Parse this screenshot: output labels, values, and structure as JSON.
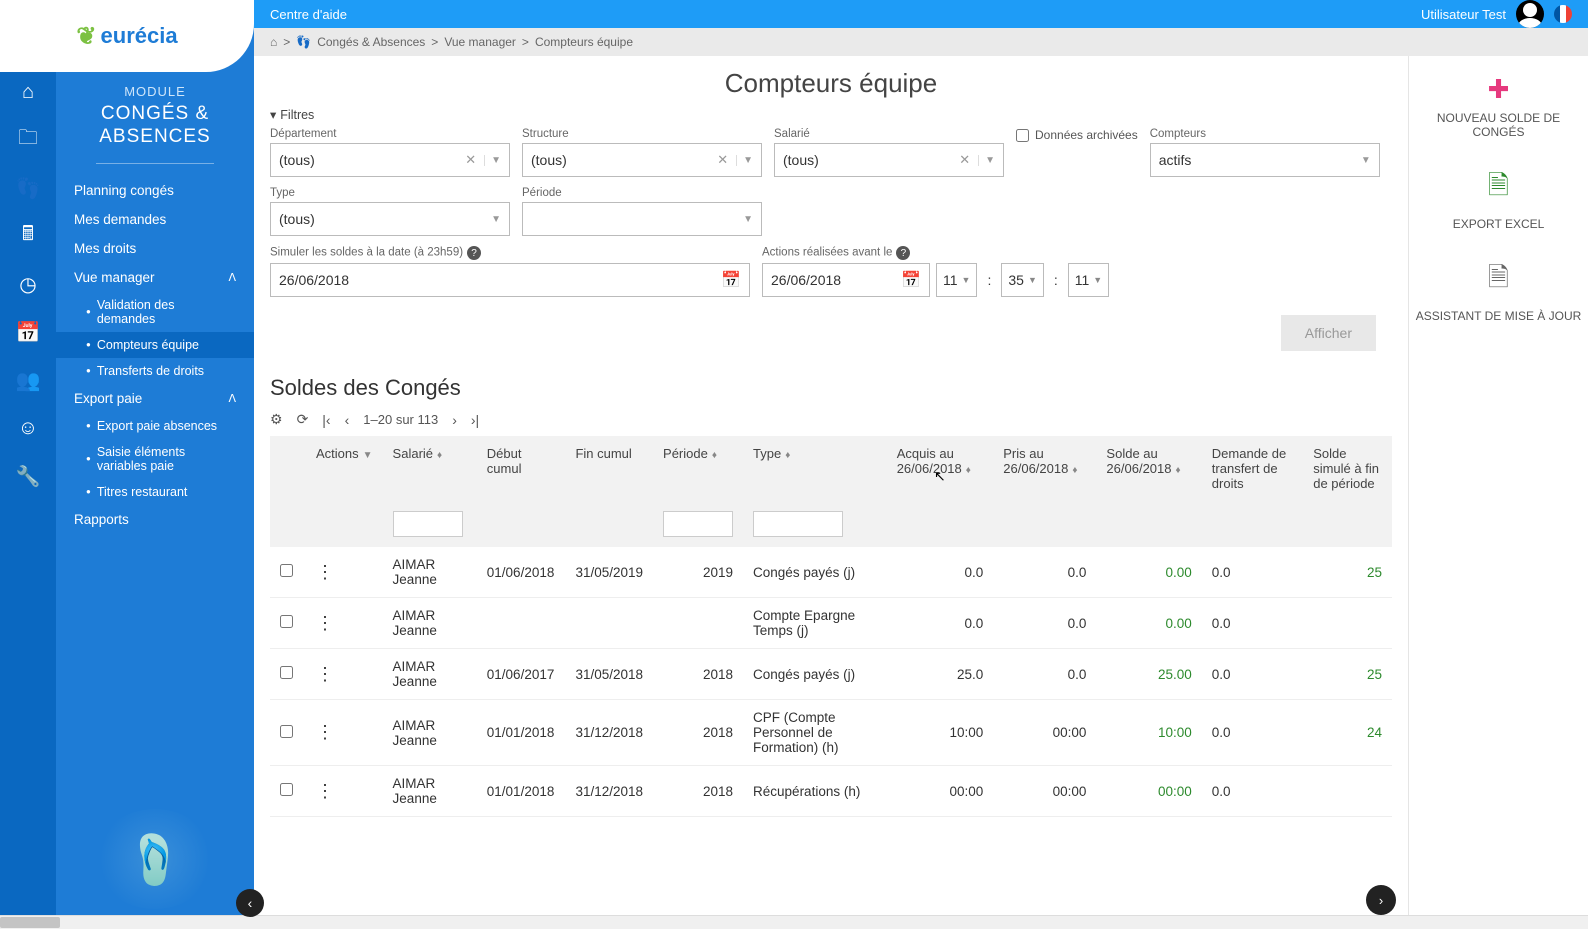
{
  "brand": {
    "name": "eurécia"
  },
  "topbar": {
    "help": "Centre d'aide",
    "user": "Utilisateur  Test"
  },
  "breadcrumb": {
    "sep": ">",
    "mod": "Congés & Absences",
    "view": "Vue manager",
    "page": "Compteurs équipe"
  },
  "sidebar": {
    "module_label": "MODULE",
    "module_name": "CONGÉS & ABSENCES",
    "items": {
      "planning": "Planning congés",
      "demandes": "Mes demandes",
      "droits": "Mes droits",
      "vue_manager": "Vue manager",
      "export_paie": "Export paie",
      "rapports": "Rapports"
    },
    "vue_manager_sub": {
      "validation": "Validation des demandes",
      "compteurs": "Compteurs équipe",
      "transferts": "Transferts de droits"
    },
    "export_paie_sub": {
      "absences": "Export paie absences",
      "elements": "Saisie éléments variables paie",
      "titres": "Titres restaurant"
    }
  },
  "page": {
    "title": "Compteurs équipe"
  },
  "filters": {
    "header": "Filtres",
    "departement": {
      "label": "Département",
      "value": "(tous)"
    },
    "structure": {
      "label": "Structure",
      "value": "(tous)"
    },
    "salarie": {
      "label": "Salarié",
      "value": "(tous)"
    },
    "archived": {
      "label": "Données archivées"
    },
    "compteurs": {
      "label": "Compteurs",
      "value": "actifs"
    },
    "type": {
      "label": "Type",
      "value": "(tous)"
    },
    "periode": {
      "label": "Période",
      "value": ""
    },
    "simuler": {
      "label": "Simuler les soldes à la date (à 23h59)",
      "value": "26/06/2018"
    },
    "actions_avant": {
      "label": "Actions réalisées avant le",
      "value": "26/06/2018",
      "hh": "11",
      "mm": "35",
      "ss": "11"
    },
    "afficher": "Afficher"
  },
  "tablesection": {
    "title": "Soldes des Congés",
    "pager": "1–20 sur 113",
    "headers": {
      "actions": "Actions",
      "salarie": "Salarié",
      "debut": "Début cumul",
      "fin": "Fin cumul",
      "periode": "Période",
      "type": "Type",
      "acquis": "Acquis au 26/06/2018",
      "pris": "Pris au 26/06/2018",
      "solde": "Solde au 26/06/2018",
      "transfert": "Demande de transfert de droits",
      "simule": "Solde simulé à fin de période"
    },
    "rows": [
      {
        "salarie": "AIMAR Jeanne",
        "debut": "01/06/2018",
        "fin": "31/05/2019",
        "periode": "2019",
        "type": "Congés payés (j)",
        "acquis": "0.0",
        "pris": "0.0",
        "solde": "0.00",
        "transfert": "0.0",
        "simule": "25"
      },
      {
        "salarie": "AIMAR Jeanne",
        "debut": "",
        "fin": "",
        "periode": "",
        "type": "Compte Epargne Temps (j)",
        "acquis": "0.0",
        "pris": "0.0",
        "solde": "0.00",
        "transfert": "0.0",
        "simule": ""
      },
      {
        "salarie": "AIMAR Jeanne",
        "debut": "01/06/2017",
        "fin": "31/05/2018",
        "periode": "2018",
        "type": "Congés payés (j)",
        "acquis": "25.0",
        "pris": "0.0",
        "solde": "25.00",
        "transfert": "0.0",
        "simule": "25"
      },
      {
        "salarie": "AIMAR Jeanne",
        "debut": "01/01/2018",
        "fin": "31/12/2018",
        "periode": "2018",
        "type": "CPF (Compte Personnel de Formation) (h)",
        "acquis": "10:00",
        "pris": "00:00",
        "solde": "10:00",
        "transfert": "0.0",
        "simule": "24"
      },
      {
        "salarie": "AIMAR Jeanne",
        "debut": "01/01/2018",
        "fin": "31/12/2018",
        "periode": "2018",
        "type": "Récupérations (h)",
        "acquis": "00:00",
        "pris": "00:00",
        "solde": "00:00",
        "transfert": "0.0",
        "simule": ""
      }
    ]
  },
  "rightpanel": {
    "nouveau": "NOUVEAU SOLDE DE CONGÉS",
    "export": "EXPORT EXCEL",
    "assistant": "ASSISTANT DE MISE À JOUR"
  }
}
